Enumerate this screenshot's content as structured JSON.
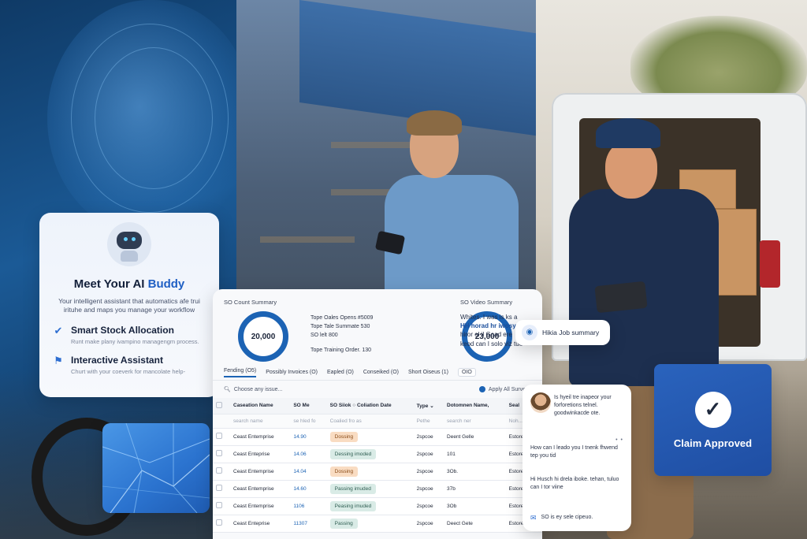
{
  "ai_buddy": {
    "title_prefix": "Meet Your AI ",
    "title_accent": "Buddy",
    "subtitle": "Your intelligent assistant that automatics afe trui irituhe and maps you manage your workflow",
    "features": [
      {
        "icon": "shield-check-icon",
        "title": "Smart Stock Allocation",
        "desc": "Runt make plany ivampino managengm process."
      },
      {
        "icon": "flag-icon",
        "title": "Interactive Assistant",
        "desc": "Churt with your coeverk for mancolate help-"
      }
    ]
  },
  "dashboard": {
    "count_summary": {
      "title": "SO Count Summary",
      "value": "20,000",
      "lines": [
        "Tope Oales Opens #5009",
        "Tope Tale Summate 530",
        "SO lelt 800",
        "Tope Training Order. 130"
      ]
    },
    "video_summary": {
      "title": "SO Video Summary",
      "value": "23,000",
      "lines": [
        "Whites. I was is ks a",
        "HH horad hr iwosy",
        "hiror ol il Goad ere",
        "keod can I solo viz tue"
      ]
    },
    "tabs": [
      "Fending (O5)",
      "Possibly Invoices (O)",
      "Eapled (O)",
      "Conseiked (O)",
      "Short Oiseus (1)",
      "OIO"
    ],
    "search_placeholder": "Choose any issue...",
    "apply_label": "Apply All Surveys",
    "columns": [
      "Caseation Name",
      "SO Me",
      "SO Siiok",
      "Coliation Date",
      "Type",
      "Dotomnen Name,",
      "Seal"
    ],
    "filter_row": [
      "search name",
      "se hled fo",
      "Coalied fro as",
      "",
      "Pethe",
      "search ner",
      "Noh..."
    ],
    "rows": [
      {
        "name": "Ceast Entemprise",
        "so": "14.90",
        "status": "Dossing",
        "status_color": "orange",
        "type": "2spcoe",
        "doc": "Deent Gelle",
        "seal": "Estore-42"
      },
      {
        "name": "Ceast Enteprise",
        "so": "14.06",
        "status": "Dessing imoded",
        "status_color": "green",
        "type": "2spcoe",
        "doc": "101",
        "seal": "Estore-36"
      },
      {
        "name": "Ceast Entemprise",
        "so": "14.04",
        "status": "Dossing",
        "status_color": "orange",
        "type": "2spcoe",
        "doc": "3Ob.",
        "seal": "Estore-26"
      },
      {
        "name": "Ceast Entemprise",
        "so": "14.60",
        "status": "Passing imuded",
        "status_color": "green",
        "type": "2spcoe",
        "doc": "37b",
        "seal": "Estore-43"
      },
      {
        "name": "Ceast Entemprise",
        "so": "1106",
        "status": "Peasing imuded",
        "status_color": "green",
        "type": "2spcoe",
        "doc": "3Ob",
        "seal": "Estore-32"
      },
      {
        "name": "Ceast Enteprise",
        "so": "11307",
        "status": "Passing",
        "status_color": "green",
        "type": "2spcoe",
        "doc": "Deect Gete",
        "seal": "Estore-88"
      }
    ]
  },
  "job_summary": {
    "label": "Hikia Job summary"
  },
  "chat": {
    "msg1": "Is hyeil tre inapeor your forforetions telnel. goodwinkacde ote.",
    "typing": "• •",
    "msg2": "How can I leado you I tnenk fhwend tep you tid",
    "msg3": "Hi Husch hi drela iboke. tehan, tuluo can I tor viine",
    "footer": "SO is ey sele cipeuo."
  },
  "claim": {
    "label": "Claim Approved"
  },
  "colors": {
    "accent": "#1c63b4",
    "claim_bg": "#2a63bd",
    "pill_orange": "#f9dcc2",
    "pill_green": "#d9ebe6"
  }
}
